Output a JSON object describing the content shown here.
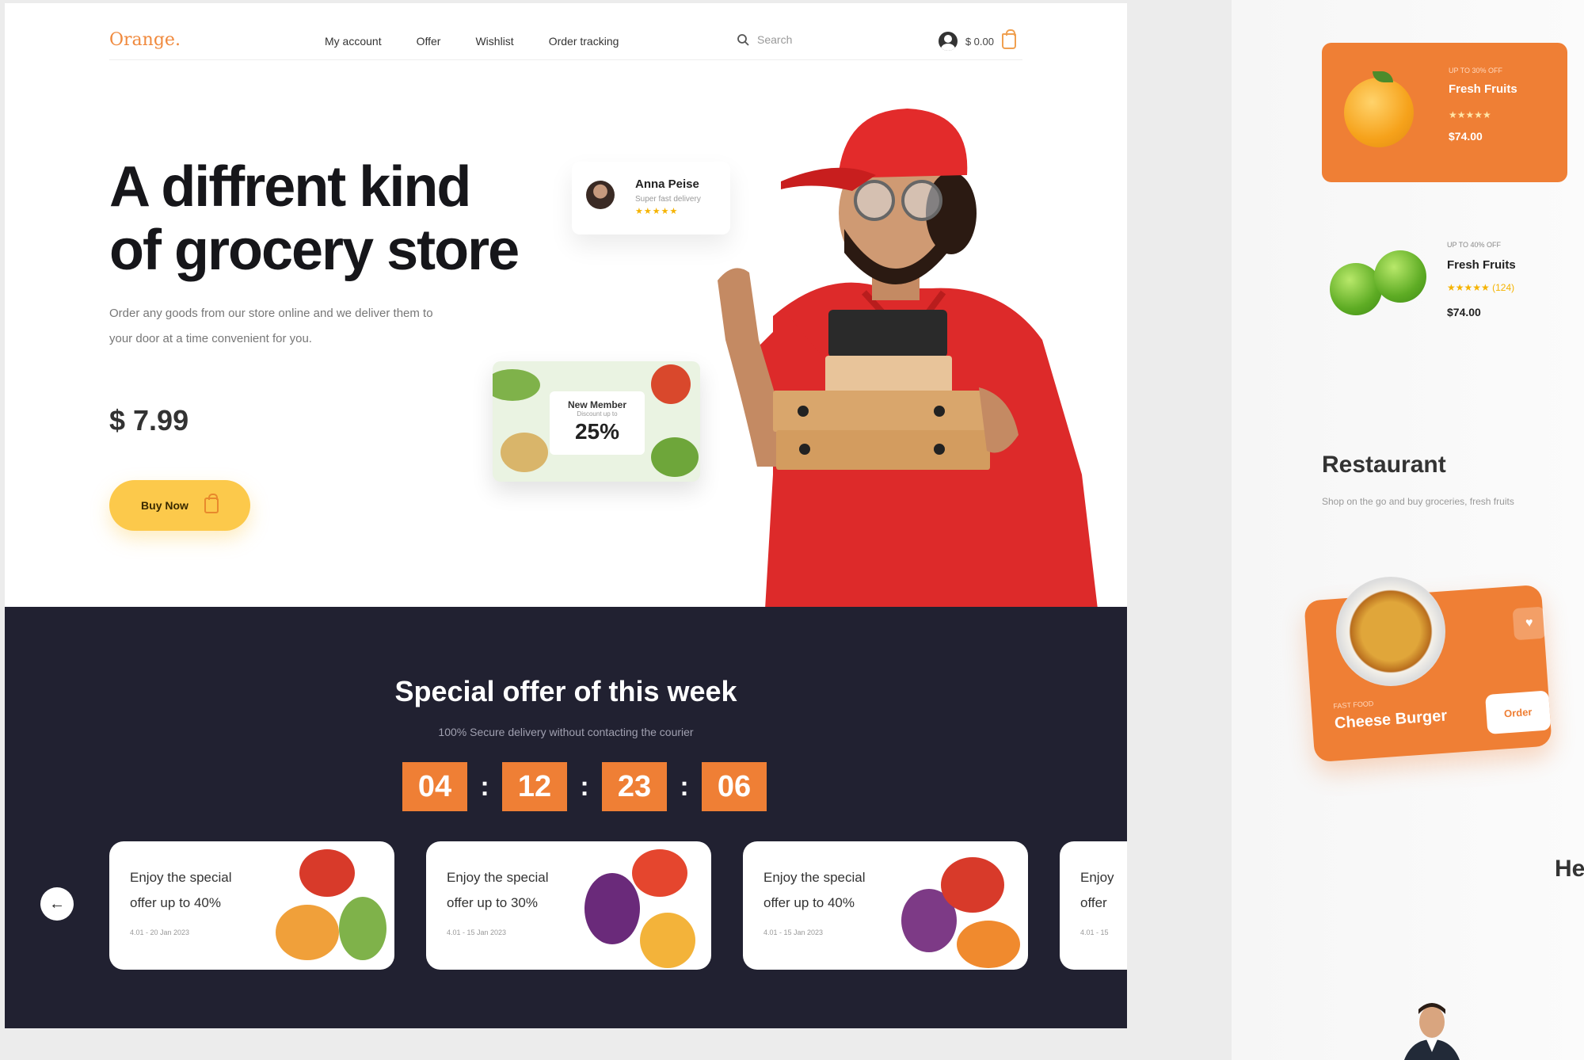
{
  "nav": {
    "logo": "Orange.",
    "links": [
      "My account",
      "Offer",
      "Wishlist",
      "Order tracking"
    ],
    "search_placeholder": "Search",
    "account_amount": "$ 0.00"
  },
  "hero": {
    "title_line1": "A diffrent kind",
    "title_line2": "of grocery store",
    "subtitle": "Order any goods from our store online and we deliver them to your door at a time convenient for you.",
    "price": "$ 7.99",
    "buy_label": "Buy Now"
  },
  "review": {
    "name": "Anna Peise",
    "role": "Super fast delivery",
    "stars": "★★★★★"
  },
  "promo": {
    "title": "New Member",
    "subtitle": "Discount up to",
    "percent": "25%"
  },
  "offer": {
    "title": "Special offer of this week",
    "subtitle": "100% Secure delivery without contacting the courier",
    "timer": [
      "04",
      "12",
      "23",
      "06"
    ],
    "cards": [
      {
        "line1": "Enjoy the special",
        "line2": "offer up to 40%",
        "date": "4.01 - 20 Jan 2023"
      },
      {
        "line1": "Enjoy the special",
        "line2": "offer up to 30%",
        "date": "4.01 - 15 Jan 2023"
      },
      {
        "line1": "Enjoy the special",
        "line2": "offer up to 40%",
        "date": "4.01 - 15 Jan 2023"
      },
      {
        "line1": "Enjoy",
        "line2": "offer",
        "date": "4.01 - 15"
      }
    ]
  },
  "side": {
    "fresh_card": {
      "tag": "UP TO 30% OFF",
      "name": "Fresh Fruits",
      "stars": "★★★★★",
      "price": "$74.00"
    },
    "apple_item": {
      "tag": "UP TO 40% OFF",
      "name": "Fresh Fruits",
      "stars": "★★★★★ (124)",
      "price": "$74.00"
    },
    "restaurant_title": "Restaurant",
    "restaurant_sub": "Shop on the go and buy groceries, fresh fruits",
    "burger": {
      "tag": "FAST FOOD",
      "name": "Cheese Burger",
      "button": "Order"
    },
    "partial_heading": "He"
  },
  "colors": {
    "accent": "#ef7f35",
    "dark_band": "#212131",
    "buy_button": "#fcc94b"
  }
}
